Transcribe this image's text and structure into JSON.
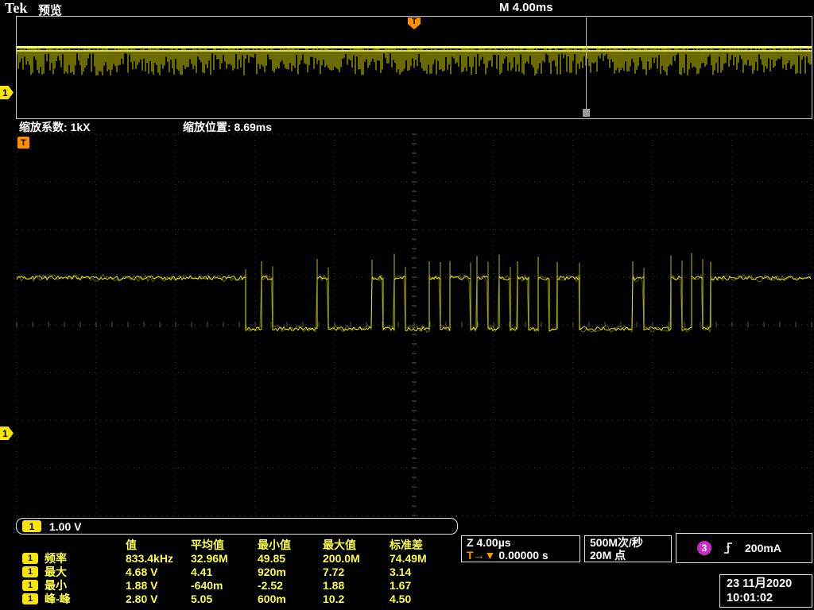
{
  "header": {
    "logo": "Tek",
    "mode": "预览",
    "timebase": "M 4.00ms"
  },
  "overview": {
    "trigger_marker": "T",
    "channel_marker": "1"
  },
  "zoom_bar": {
    "factor_label": "缩放系数: 1kX",
    "position_label": "缩放位置:  8.69ms"
  },
  "graticule": {
    "trigger_flag": "T",
    "channel_marker": "1"
  },
  "channel_bar": {
    "channel": "1",
    "scale": "1.00 V"
  },
  "measurements": {
    "col_headers": [
      "值",
      "平均值",
      "最小值",
      "最大值",
      "标准差"
    ],
    "rows": [
      {
        "ch": "1",
        "name": "频率",
        "values": [
          "833.4kHz",
          "32.96M",
          "49.85",
          "200.0M",
          "74.49M"
        ]
      },
      {
        "ch": "1",
        "name": "最大",
        "values": [
          "4.68 V",
          "4.41",
          "920m",
          "7.72",
          "3.14"
        ]
      },
      {
        "ch": "1",
        "name": "最小",
        "values": [
          "1.88 V",
          "-640m",
          "-2.52",
          "1.88",
          "1.67"
        ]
      },
      {
        "ch": "1",
        "name": "峰-峰",
        "values": [
          "2.80 V",
          "5.05",
          "600m",
          "10.2",
          "4.50"
        ]
      }
    ]
  },
  "status": {
    "zoom_timebase": "Z 4.00µs",
    "trigger_marker": "T→▼",
    "trigger_position": "0.00000 s",
    "sample_rate": "500M次/秒",
    "record_length": "20M 点",
    "trigger_source_ch": "3",
    "trigger_level": "200mA",
    "date": "23 11月2020",
    "time": "10:01:02"
  },
  "colors": {
    "ch1": "#ffff00",
    "ch3": "#c82cc8",
    "trigger_orange": "#ff9000"
  },
  "chart_data": {
    "type": "line",
    "title": "CH1 digital serial burst, zoomed view",
    "x_axis": {
      "scale_per_div": "4.00 µs",
      "divisions": 10
    },
    "y_axis": {
      "scale_per_div": "1.00 V",
      "divisions": 8
    },
    "grid": "dotted",
    "series": [
      {
        "name": "CH1",
        "color": "#ffff00",
        "kind": "digital",
        "start_level": "high",
        "high_v": 3.2,
        "low_v": 2.2,
        "transition_x_frac": [
          0.288,
          0.308,
          0.322,
          0.378,
          0.392,
          0.447,
          0.461,
          0.475,
          0.489,
          0.519,
          0.533,
          0.545,
          0.571,
          0.579,
          0.593,
          0.607,
          0.621,
          0.63,
          0.644,
          0.656,
          0.67,
          0.68,
          0.708,
          0.775,
          0.789,
          0.823,
          0.837,
          0.849,
          0.863,
          0.873
        ]
      }
    ],
    "overview": {
      "description": "Full 40 ms record shown as dense yellow band with zoom window cursor at 8.69 ms"
    }
  }
}
